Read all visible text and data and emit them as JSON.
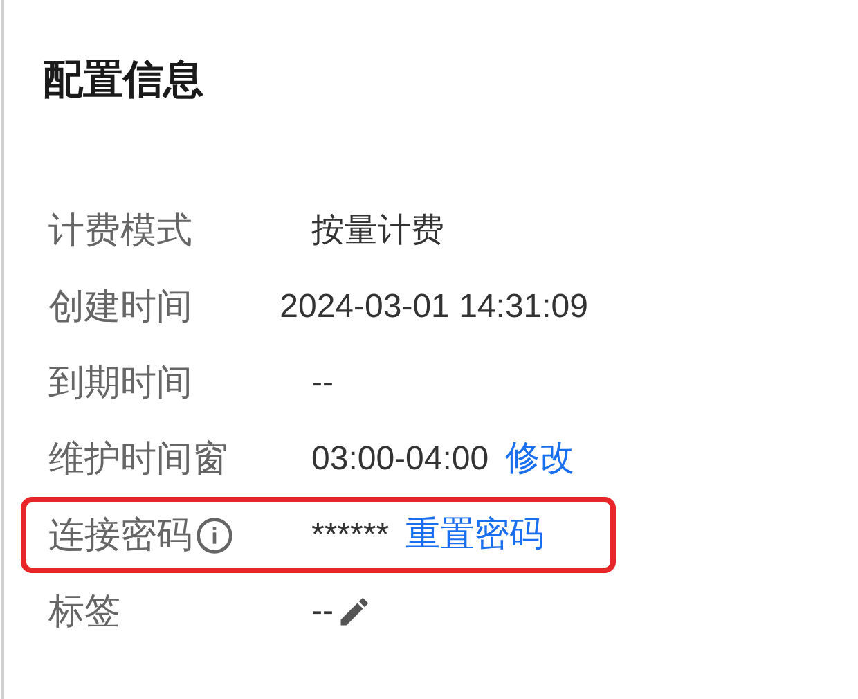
{
  "title": "配置信息",
  "rows": [
    {
      "kind": "text",
      "label": "计费模式",
      "value": "按量计费",
      "highlighted": false
    },
    {
      "kind": "text",
      "label": "创建时间",
      "value": "2024-03-01 14:31:09",
      "highlighted": false
    },
    {
      "kind": "text",
      "label": "到期时间",
      "value": "--",
      "highlighted": false
    },
    {
      "kind": "link",
      "label": "维护时间窗",
      "value": "03:00-04:00",
      "link": "修改",
      "highlighted": false
    },
    {
      "kind": "password",
      "label": "连接密码",
      "value": "******",
      "link": "重置密码",
      "highlighted": true
    },
    {
      "kind": "tag",
      "label": "标签",
      "value": "--",
      "highlighted": false
    }
  ]
}
